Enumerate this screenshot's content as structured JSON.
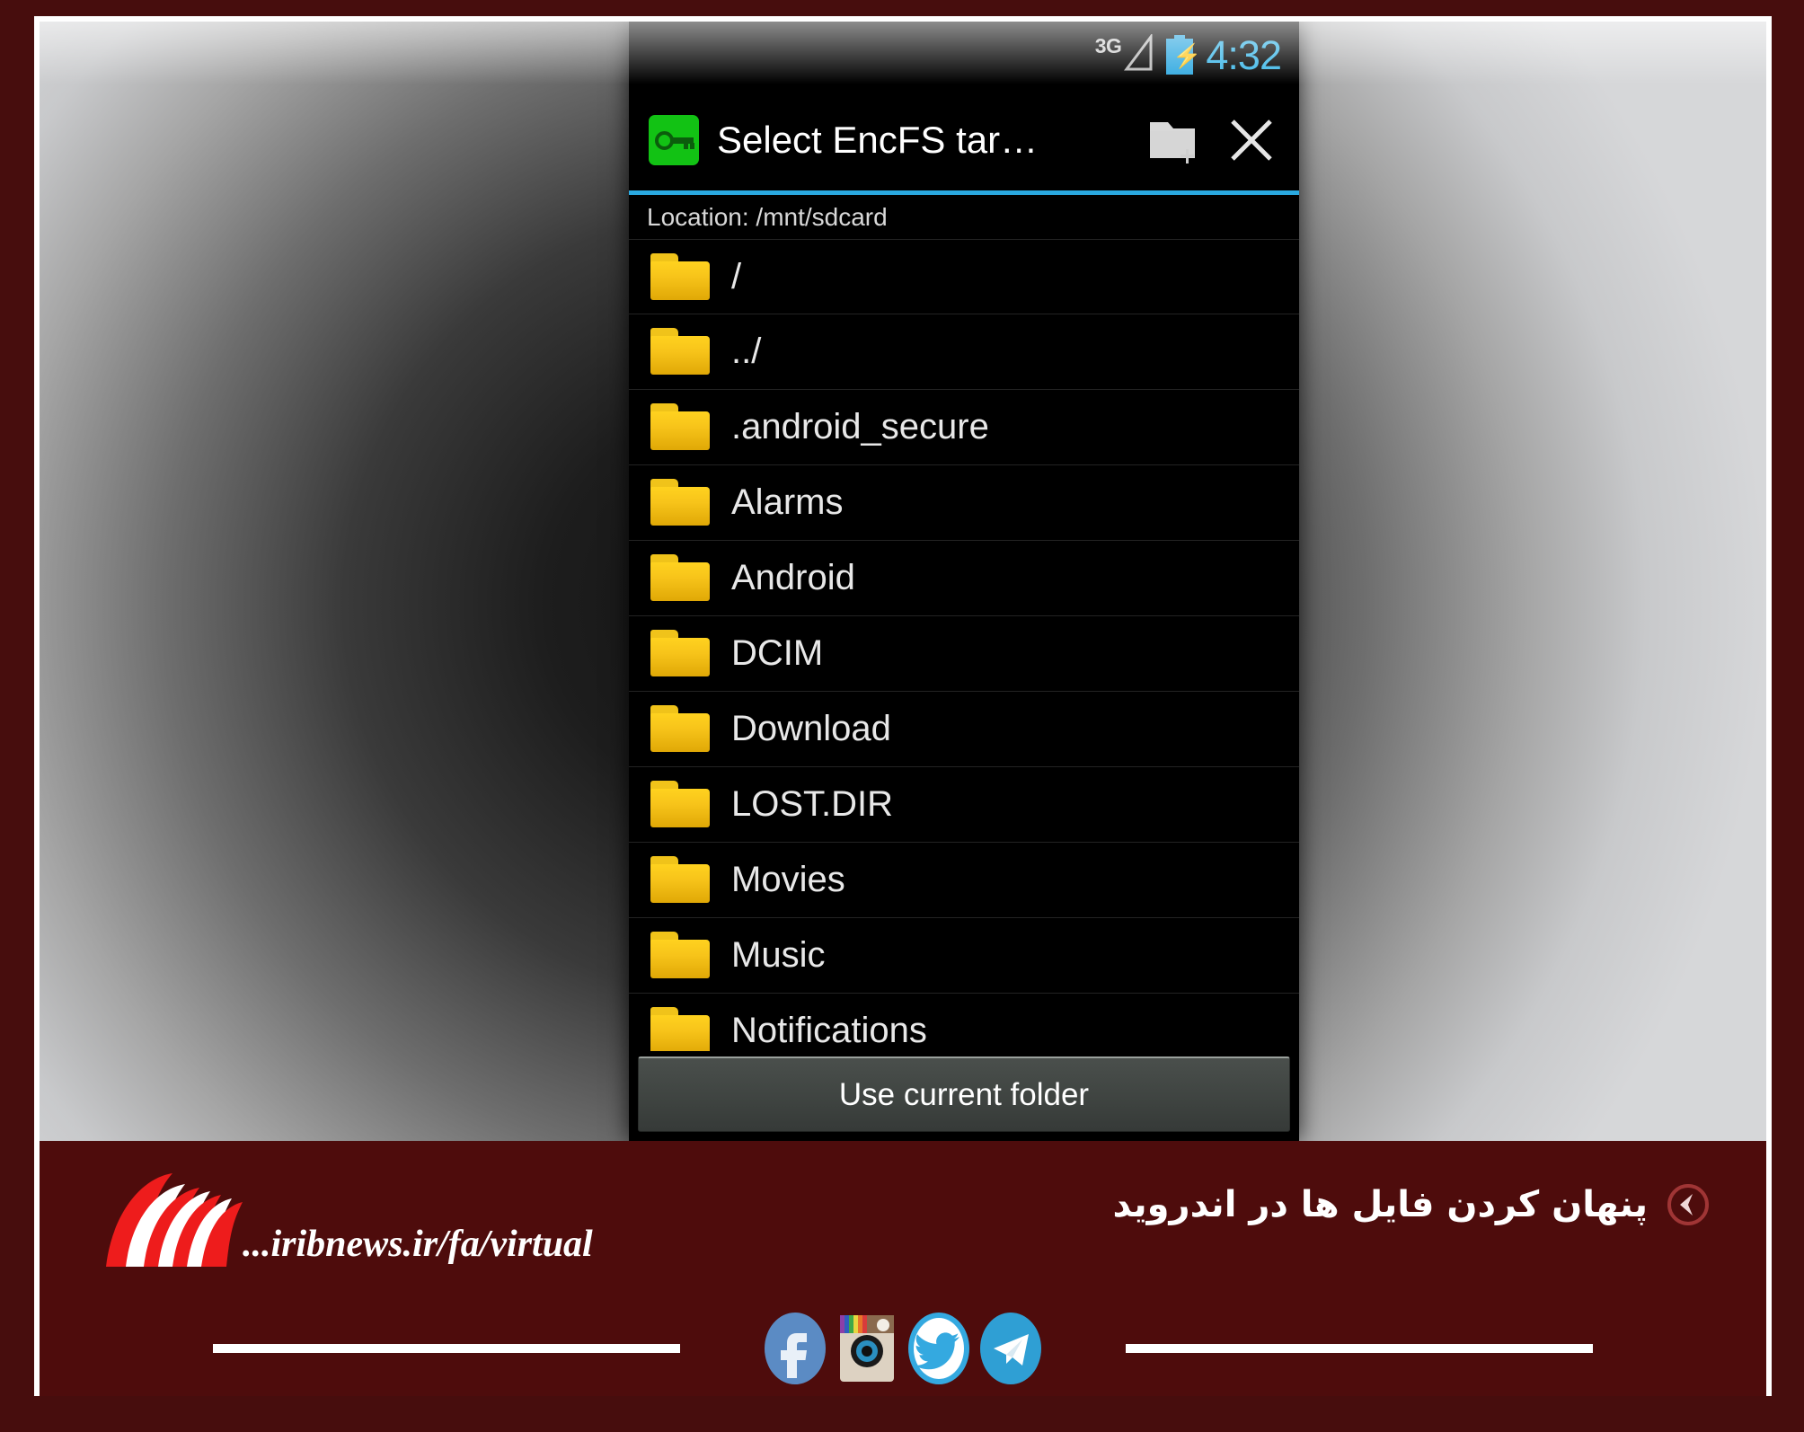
{
  "phone": {
    "status_bar": {
      "network_label": "3G",
      "battery_state": "charging",
      "time": "4:32",
      "clock_color": "#3ab6e8"
    },
    "action_bar": {
      "app_icon": "key-icon",
      "title": "Select EncFS tar…",
      "new_folder_label": "new-folder-icon",
      "close_label": "close-icon",
      "accent_color": "#2aa9e0"
    },
    "location": "Location: /mnt/sdcard",
    "files": [
      {
        "name": "/",
        "icon": "folder-icon"
      },
      {
        "name": "../",
        "icon": "folder-icon"
      },
      {
        "name": ".android_secure",
        "icon": "folder-icon"
      },
      {
        "name": "Alarms",
        "icon": "folder-icon"
      },
      {
        "name": "Android",
        "icon": "folder-icon"
      },
      {
        "name": "DCIM",
        "icon": "folder-icon"
      },
      {
        "name": "Download",
        "icon": "folder-icon"
      },
      {
        "name": "LOST.DIR",
        "icon": "folder-icon"
      },
      {
        "name": "Movies",
        "icon": "folder-icon"
      },
      {
        "name": "Music",
        "icon": "folder-icon"
      },
      {
        "name": "Notifications",
        "icon": "folder-icon"
      }
    ],
    "use_current_folder_label": "Use current folder"
  },
  "banner": {
    "background_color": "#4e0c0c",
    "logo_name": "irib-logo",
    "site_url": "...iribnews.ir/fa/virtual",
    "headline": "پنهان کردن فایل ها در اندروید",
    "back_badge": "back-chevron-icon",
    "social": [
      {
        "name": "facebook-icon",
        "color": "#5b8bc4"
      },
      {
        "name": "instagram-icon",
        "color": "#c9a88a"
      },
      {
        "name": "twitter-icon",
        "color": "#34a9e0"
      },
      {
        "name": "telegram-icon",
        "color": "#2f9fd4"
      }
    ]
  }
}
